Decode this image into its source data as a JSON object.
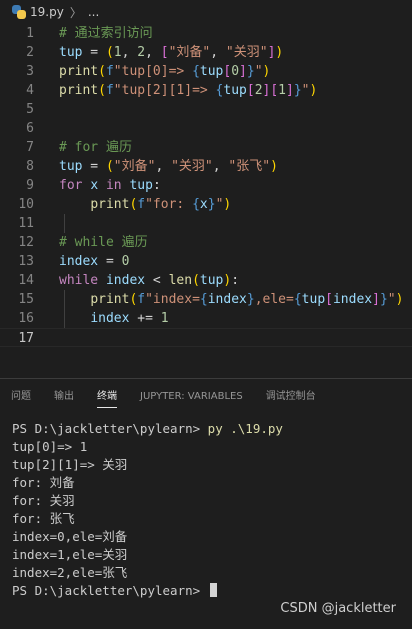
{
  "breadcrumb": {
    "file": "19.py",
    "separator": "〉",
    "rest": "..."
  },
  "editor": {
    "lines": [
      {
        "n": "1",
        "tokens": [
          {
            "t": "# 通过索引访问",
            "c": "k-cmt"
          }
        ]
      },
      {
        "n": "2",
        "tokens": [
          {
            "t": "tup",
            "c": "k-id"
          },
          {
            "t": " = ",
            "c": "k-op"
          },
          {
            "t": "(",
            "c": "k-b1"
          },
          {
            "t": "1",
            "c": "k-num"
          },
          {
            "t": ", ",
            "c": "k-op"
          },
          {
            "t": "2",
            "c": "k-num"
          },
          {
            "t": ", ",
            "c": "k-op"
          },
          {
            "t": "[",
            "c": "k-b2"
          },
          {
            "t": "\"刘备\"",
            "c": "k-str"
          },
          {
            "t": ", ",
            "c": "k-op"
          },
          {
            "t": "\"关羽\"",
            "c": "k-str"
          },
          {
            "t": "]",
            "c": "k-b2"
          },
          {
            "t": ")",
            "c": "k-b1"
          }
        ]
      },
      {
        "n": "3",
        "tokens": [
          {
            "t": "print",
            "c": "k-fn"
          },
          {
            "t": "(",
            "c": "k-b1"
          },
          {
            "t": "f",
            "c": "k-fpre"
          },
          {
            "t": "\"tup[0]=> ",
            "c": "k-str"
          },
          {
            "t": "{",
            "c": "k-fpre"
          },
          {
            "t": "tup",
            "c": "k-id"
          },
          {
            "t": "[",
            "c": "k-b2"
          },
          {
            "t": "0",
            "c": "k-num"
          },
          {
            "t": "]",
            "c": "k-b2"
          },
          {
            "t": "}",
            "c": "k-fpre"
          },
          {
            "t": "\"",
            "c": "k-str"
          },
          {
            "t": ")",
            "c": "k-b1"
          }
        ]
      },
      {
        "n": "4",
        "tokens": [
          {
            "t": "print",
            "c": "k-fn"
          },
          {
            "t": "(",
            "c": "k-b1"
          },
          {
            "t": "f",
            "c": "k-fpre"
          },
          {
            "t": "\"tup[2][1]=> ",
            "c": "k-str"
          },
          {
            "t": "{",
            "c": "k-fpre"
          },
          {
            "t": "tup",
            "c": "k-id"
          },
          {
            "t": "[",
            "c": "k-b2"
          },
          {
            "t": "2",
            "c": "k-num"
          },
          {
            "t": "]",
            "c": "k-b2"
          },
          {
            "t": "[",
            "c": "k-b2"
          },
          {
            "t": "1",
            "c": "k-num"
          },
          {
            "t": "]",
            "c": "k-b2"
          },
          {
            "t": "}",
            "c": "k-fpre"
          },
          {
            "t": "\"",
            "c": "k-str"
          },
          {
            "t": ")",
            "c": "k-b1"
          }
        ]
      },
      {
        "n": "5",
        "tokens": []
      },
      {
        "n": "6",
        "tokens": []
      },
      {
        "n": "7",
        "tokens": [
          {
            "t": "# for 遍历",
            "c": "k-cmt"
          }
        ]
      },
      {
        "n": "8",
        "tokens": [
          {
            "t": "tup",
            "c": "k-id"
          },
          {
            "t": " = ",
            "c": "k-op"
          },
          {
            "t": "(",
            "c": "k-b1"
          },
          {
            "t": "\"刘备\"",
            "c": "k-str"
          },
          {
            "t": ", ",
            "c": "k-op"
          },
          {
            "t": "\"关羽\"",
            "c": "k-str"
          },
          {
            "t": ", ",
            "c": "k-op"
          },
          {
            "t": "\"张飞\"",
            "c": "k-str"
          },
          {
            "t": ")",
            "c": "k-b1"
          }
        ]
      },
      {
        "n": "9",
        "tokens": [
          {
            "t": "for",
            "c": "k-kw"
          },
          {
            "t": " ",
            "c": "k-op"
          },
          {
            "t": "x",
            "c": "k-id"
          },
          {
            "t": " ",
            "c": "k-op"
          },
          {
            "t": "in",
            "c": "k-kw"
          },
          {
            "t": " ",
            "c": "k-op"
          },
          {
            "t": "tup",
            "c": "k-id"
          },
          {
            "t": ":",
            "c": "k-op"
          }
        ]
      },
      {
        "n": "10",
        "tokens": [
          {
            "t": "    ",
            "c": "k-op"
          },
          {
            "t": "print",
            "c": "k-fn"
          },
          {
            "t": "(",
            "c": "k-b1"
          },
          {
            "t": "f",
            "c": "k-fpre"
          },
          {
            "t": "\"for: ",
            "c": "k-str"
          },
          {
            "t": "{",
            "c": "k-fpre"
          },
          {
            "t": "x",
            "c": "k-id"
          },
          {
            "t": "}",
            "c": "k-fpre"
          },
          {
            "t": "\"",
            "c": "k-str"
          },
          {
            "t": ")",
            "c": "k-b1"
          }
        ]
      },
      {
        "n": "11",
        "tokens": []
      },
      {
        "n": "12",
        "tokens": [
          {
            "t": "# while 遍历",
            "c": "k-cmt"
          }
        ]
      },
      {
        "n": "13",
        "tokens": [
          {
            "t": "index",
            "c": "k-id"
          },
          {
            "t": " = ",
            "c": "k-op"
          },
          {
            "t": "0",
            "c": "k-num"
          }
        ]
      },
      {
        "n": "14",
        "tokens": [
          {
            "t": "while",
            "c": "k-kw"
          },
          {
            "t": " ",
            "c": "k-op"
          },
          {
            "t": "index",
            "c": "k-id"
          },
          {
            "t": " < ",
            "c": "k-op"
          },
          {
            "t": "len",
            "c": "k-fn"
          },
          {
            "t": "(",
            "c": "k-b1"
          },
          {
            "t": "tup",
            "c": "k-id"
          },
          {
            "t": ")",
            "c": "k-b1"
          },
          {
            "t": ":",
            "c": "k-op"
          }
        ]
      },
      {
        "n": "15",
        "tokens": [
          {
            "t": "    ",
            "c": "k-op"
          },
          {
            "t": "print",
            "c": "k-fn"
          },
          {
            "t": "(",
            "c": "k-b1"
          },
          {
            "t": "f",
            "c": "k-fpre"
          },
          {
            "t": "\"index=",
            "c": "k-str"
          },
          {
            "t": "{",
            "c": "k-fpre"
          },
          {
            "t": "index",
            "c": "k-id"
          },
          {
            "t": "}",
            "c": "k-fpre"
          },
          {
            "t": ",ele=",
            "c": "k-str"
          },
          {
            "t": "{",
            "c": "k-fpre"
          },
          {
            "t": "tup",
            "c": "k-id"
          },
          {
            "t": "[",
            "c": "k-b2"
          },
          {
            "t": "index",
            "c": "k-id"
          },
          {
            "t": "]",
            "c": "k-b2"
          },
          {
            "t": "}",
            "c": "k-fpre"
          },
          {
            "t": "\"",
            "c": "k-str"
          },
          {
            "t": ")",
            "c": "k-b1"
          }
        ]
      },
      {
        "n": "16",
        "tokens": [
          {
            "t": "    ",
            "c": "k-op"
          },
          {
            "t": "index",
            "c": "k-id"
          },
          {
            "t": " += ",
            "c": "k-op"
          },
          {
            "t": "1",
            "c": "k-num"
          }
        ]
      },
      {
        "n": "17",
        "tokens": [],
        "active": true
      }
    ]
  },
  "panel": {
    "tabs": [
      {
        "label": "问题",
        "active": false
      },
      {
        "label": "输出",
        "active": false
      },
      {
        "label": "终端",
        "active": true
      },
      {
        "label": "JUPYTER: VARIABLES",
        "active": false
      },
      {
        "label": "调试控制台",
        "active": false
      }
    ]
  },
  "terminal": {
    "lines": [
      {
        "prompt": "PS D:\\jackletter\\pylearn> ",
        "cmd": "py .\\19.py"
      },
      {
        "text": "tup[0]=> 1"
      },
      {
        "text": "tup[2][1]=> 关羽"
      },
      {
        "text": "for: 刘备"
      },
      {
        "text": "for: 关羽"
      },
      {
        "text": "for: 张飞"
      },
      {
        "text": "index=0,ele=刘备"
      },
      {
        "text": "index=1,ele=关羽"
      },
      {
        "text": "index=2,ele=张飞"
      },
      {
        "prompt": "PS D:\\jackletter\\pylearn> ",
        "cursor": true
      }
    ]
  },
  "watermark": "CSDN @jackletter"
}
